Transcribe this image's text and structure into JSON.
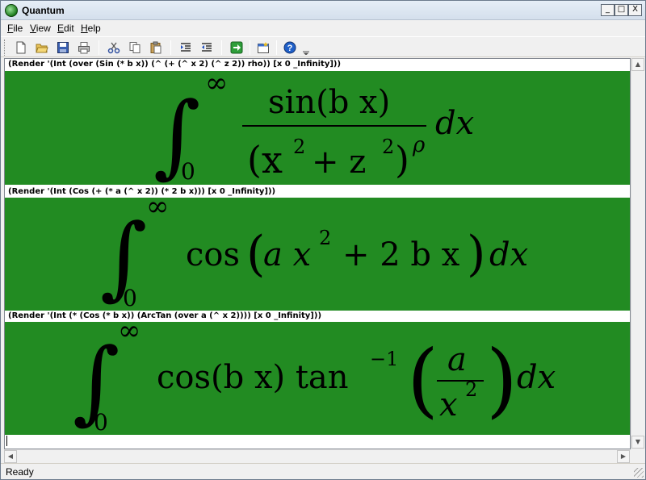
{
  "window": {
    "title": "Quantum",
    "icon": "quantum-app-icon"
  },
  "window_buttons": {
    "minimize": "_",
    "maximize": "□",
    "close": "X"
  },
  "menu": [
    {
      "label": "File",
      "accel": "F",
      "rest": "ile"
    },
    {
      "label": "View",
      "accel": "V",
      "rest": "iew"
    },
    {
      "label": "Edit",
      "accel": "E",
      "rest": "dit"
    },
    {
      "label": "Help",
      "accel": "H",
      "rest": "elp"
    }
  ],
  "toolbar": [
    "new-file-icon",
    "open-folder-icon",
    "save-icon",
    "print-icon",
    "cut-icon",
    "copy-icon",
    "paste-icon",
    "indent-icon",
    "outdent-icon",
    "run-arrow-icon",
    "new-window-icon",
    "help-icon",
    "toolbar-options-icon"
  ],
  "cells": [
    {
      "command": "(Render '(Int (over (Sin (* b x)) (^ (+ (^ x 2) (^ z 2)) rho)) [x 0 _Infinity]))"
    },
    {
      "command": "(Render '(Int (Cos (+ (* a (^ x 2)) (* 2 b x))) [x 0 _Infinity]))"
    },
    {
      "command": "(Render '(Int (* (Cos (* b x)) (ArcTan (over a (^ x 2)))) [x 0 _Infinity]))"
    }
  ],
  "math": {
    "m1": {
      "upper": "∞",
      "lower": "0",
      "num": "sin(b x)",
      "den": "(x",
      "den_exp1": "2",
      "den_plus": "+ z",
      "den_exp2": "2",
      "den_close": ")",
      "rho": "ρ",
      "dx": "dx"
    },
    "m2": {
      "upper": "∞",
      "lower": "0",
      "cos": "cos",
      "body1": "a x",
      "exp": "2",
      "body2": "+ 2 b x",
      "dx": "dx"
    },
    "m3": {
      "upper": "∞",
      "lower": "0",
      "cos": "cos(b x) tan",
      "inv": "−1",
      "num": "a",
      "den": "x",
      "den_exp": "2",
      "dx": "dx"
    }
  },
  "colors": {
    "render_bg": "#228b22",
    "math": "#000000"
  },
  "status": "Ready"
}
